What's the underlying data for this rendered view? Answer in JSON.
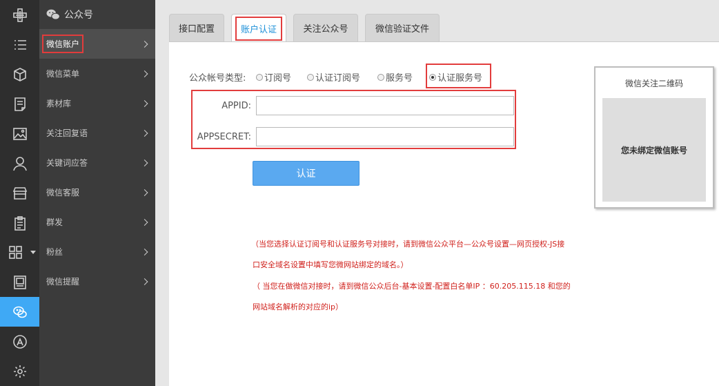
{
  "app": {
    "colors": {
      "rail_bg": "#2e2e2e",
      "submenu_bg": "#3b3b3b",
      "accent": "#3fa9f5",
      "highlight_red": "#e23c3c",
      "note_red": "#d0211c"
    }
  },
  "rail": {
    "items": [
      {
        "icon": "brand-icon"
      },
      {
        "icon": "list-icon"
      },
      {
        "icon": "cube-icon"
      },
      {
        "icon": "document-icon"
      },
      {
        "icon": "image-icon"
      },
      {
        "icon": "user-icon"
      },
      {
        "icon": "store-icon"
      },
      {
        "icon": "clipboard-icon"
      },
      {
        "icon": "grid-icon"
      },
      {
        "icon": "newspaper-icon"
      },
      {
        "icon": "wechat-icon",
        "active": true
      },
      {
        "icon": "appstore-icon"
      },
      {
        "icon": "settings-icon"
      }
    ]
  },
  "submenu": {
    "title": "公众号",
    "items": [
      {
        "label": "微信账户",
        "active": true
      },
      {
        "label": "微信菜单"
      },
      {
        "label": "素材库"
      },
      {
        "label": "关注回复语"
      },
      {
        "label": "关键词应答"
      },
      {
        "label": "微信客服"
      },
      {
        "label": "群发"
      },
      {
        "label": "粉丝"
      },
      {
        "label": "微信提醒"
      }
    ]
  },
  "tabs": [
    {
      "label": "接口配置"
    },
    {
      "label": "账户认证",
      "active": true
    },
    {
      "label": "关注公众号"
    },
    {
      "label": "微信验证文件"
    }
  ],
  "form": {
    "account_type_label": "公众帐号类型:",
    "account_types": [
      {
        "label": "订阅号",
        "checked": false
      },
      {
        "label": "认证订阅号",
        "checked": false
      },
      {
        "label": "服务号",
        "checked": false
      },
      {
        "label": "认证服务号",
        "checked": true
      }
    ],
    "appid_label": "APPID:",
    "appid_value": "",
    "appsecret_label": "APPSECRET:",
    "appsecret_value": "",
    "submit_label": "认证"
  },
  "qr": {
    "title": "微信关注二维码",
    "empty_text": "您未绑定微信账号"
  },
  "notes": [
    "（当您选择认证订阅号和认证服务号对接时，请到微信公众平台—公众号设置—网页授权-JS接",
    "口安全域名设置中填写您微网站绑定的域名。）",
    "（ 当您在做微信对接时，请到微信公众后台-基本设置-配置白名单IP ：60.205.115.18 和您的",
    "网站域名解析的对应的ip）"
  ]
}
